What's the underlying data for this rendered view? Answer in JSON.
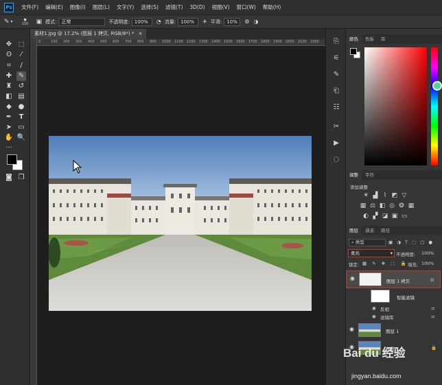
{
  "app": {
    "logo": "Ps"
  },
  "menu": [
    "文件(F)",
    "编辑(E)",
    "图像(I)",
    "图层(L)",
    "文字(Y)",
    "选择(S)",
    "滤镜(T)",
    "3D(D)",
    "视图(V)",
    "窗口(W)",
    "帮助(H)"
  ],
  "options": {
    "brush_size": "150",
    "mode_label": "模式:",
    "mode_value": "正常",
    "opacity_label": "不透明度:",
    "opacity_value": "100%",
    "flow_label": "流量:",
    "flow_value": "100%",
    "smooth_label": "平滑:",
    "smooth_value": "10%"
  },
  "document": {
    "tab_title": "素材1.jpg @ 17.2% (图层 1 拷贝, RGB/8*) *",
    "close": "×",
    "ruler_ticks": [
      "0",
      "100",
      "200",
      "300",
      "400",
      "500",
      "600",
      "700",
      "800",
      "900",
      "1000",
      "1100",
      "1200",
      "1300",
      "1400",
      "1500",
      "1600",
      "1700",
      "1800",
      "1900",
      "2000",
      "2100",
      "2200"
    ]
  },
  "color_panel": {
    "tabs": [
      "颜色",
      "色板",
      "库"
    ]
  },
  "adjust_panel": {
    "tabs": [
      "调整",
      "字符"
    ],
    "add_label": "添加调整"
  },
  "layers_panel": {
    "tabs": [
      "图层",
      "通道",
      "路径"
    ],
    "filter_label": "类型",
    "blend_mode": "柔光",
    "opacity_label": "不透明度:",
    "opacity_value": "100%",
    "lock_label": "锁定:",
    "fill_label": "填充:",
    "fill_value": "100%",
    "layers": [
      {
        "name": "图层 1 拷贝",
        "selected": true
      },
      {
        "name": "智能滤镜"
      },
      {
        "name": "反相"
      },
      {
        "name": "滤镜库"
      },
      {
        "name": "图层 1"
      },
      {
        "name": "背景"
      }
    ]
  },
  "watermark": {
    "brand": "Bai du 经验",
    "url": "jingyan.baidu.com"
  },
  "colors": {
    "accent": "#31a8ff",
    "selection_outline": "#c0392b",
    "foreground": "#000000",
    "background": "#ffffff"
  },
  "icons": [
    "brush-icon",
    "move-icon",
    "marquee-icon",
    "lasso-icon",
    "magic-wand-icon",
    "crop-icon",
    "eyedropper-icon",
    "healing-icon",
    "stamp-icon",
    "history-brush-icon",
    "eraser-icon",
    "gradient-icon",
    "blur-icon",
    "dodge-icon",
    "pen-icon",
    "type-icon",
    "path-select-icon",
    "rectangle-icon",
    "hand-icon",
    "zoom-icon",
    "more-icon",
    "eye-icon",
    "gear-icon"
  ]
}
